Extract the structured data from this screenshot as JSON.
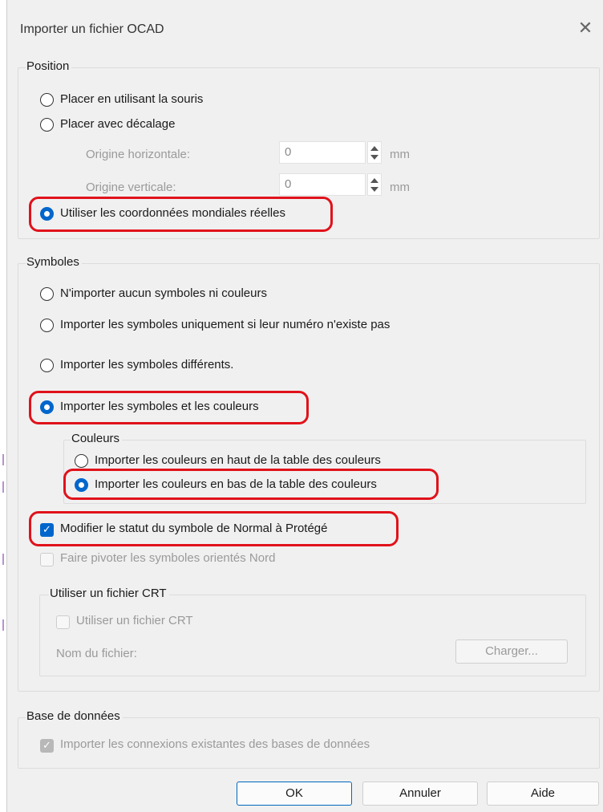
{
  "window": {
    "title": "Importer un fichier OCAD",
    "close_glyph": "✕"
  },
  "position": {
    "legend": "Position",
    "options": [
      {
        "label": "Placer en utilisant la souris",
        "selected": false
      },
      {
        "label": "Placer avec décalage",
        "selected": false
      },
      {
        "label": "Utiliser les coordonnées mondiales réelles",
        "selected": true
      }
    ],
    "origin_h_label": "Origine horizontale:",
    "origin_h_value": "0",
    "origin_v_label": "Origine verticale:",
    "origin_v_value": "0",
    "unit": "mm"
  },
  "symboles": {
    "legend": "Symboles",
    "options": [
      {
        "label": "N'importer aucun symboles ni couleurs",
        "selected": false
      },
      {
        "label": "Importer les symboles uniquement si leur numéro n'existe pas",
        "selected": false
      },
      {
        "label": "Importer les symboles différents.",
        "selected": false
      },
      {
        "label": "Importer les symboles et les couleurs",
        "selected": true
      }
    ],
    "couleurs": {
      "legend": "Couleurs",
      "options": [
        {
          "label": "Importer les couleurs en haut de la table des couleurs",
          "selected": false
        },
        {
          "label": "Importer les couleurs en bas de la table des couleurs",
          "selected": true
        }
      ]
    },
    "modify_status_label": "Modifier le statut du symbole de Normal à Protégé",
    "modify_status_checked": true,
    "rotate_label": "Faire pivoter les symboles orientés Nord",
    "rotate_checked": false,
    "crt": {
      "legend": "Utiliser un fichier CRT",
      "use_label": "Utiliser un fichier CRT",
      "use_checked": false,
      "filename_label": "Nom du fichier:",
      "load_button": "Charger..."
    }
  },
  "database": {
    "legend": "Base de données",
    "import_label": "Importer les connexions existantes des bases de données",
    "import_checked": true
  },
  "buttons": {
    "ok": "OK",
    "cancel": "Annuler",
    "help": "Aide"
  },
  "colors": {
    "accent": "#0066cc",
    "highlight": "#e0121b",
    "dialog_bg": "#f0f0f0"
  }
}
